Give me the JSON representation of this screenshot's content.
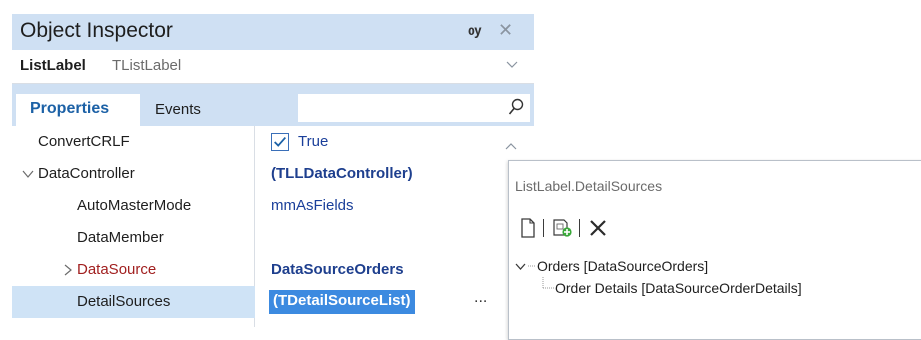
{
  "inspector": {
    "title": "Object Inspector",
    "pin_glyph": "ѹ",
    "close_glyph": "✕",
    "object_name": "ListLabel",
    "object_class": "TListLabel",
    "tabs": [
      {
        "label": "Properties",
        "active": true
      },
      {
        "label": "Events",
        "active": false
      }
    ],
    "search": {
      "value": "",
      "placeholder": ""
    },
    "properties": [
      {
        "name": "ConvertCRLF",
        "value": "True",
        "kind": "checkbox",
        "checked": true
      },
      {
        "name": "DataController",
        "value": "(TLLDataController)",
        "kind": "object",
        "expanded": true
      },
      {
        "name": "AutoMasterMode",
        "value": "mmAsFields",
        "kind": "enum"
      },
      {
        "name": "DataMember",
        "value": "",
        "kind": "string"
      },
      {
        "name": "DataSource",
        "value": "DataSourceOrders",
        "kind": "reference",
        "expanded": false
      },
      {
        "name": "DetailSources",
        "value": "(TDetailSourceList)",
        "kind": "object",
        "selected": true,
        "ellipsis": "..."
      }
    ]
  },
  "detail_sources": {
    "title": "ListLabel.DetailSources",
    "toolbar": [
      "new-icon",
      "add-item-icon",
      "delete-icon"
    ],
    "tree": [
      {
        "label": "Orders [DataSourceOrders]",
        "level": 0,
        "expanded": true
      },
      {
        "label": "Order Details [DataSourceOrderDetails]",
        "level": 1
      }
    ]
  },
  "colors": {
    "title_bar": "#cfe0f3",
    "tab_active_text": "#1c61a6",
    "value_text": "#1e3f8e",
    "reference_name": "#a11f1f",
    "selection": "#3c8ae0",
    "row_highlight": "#cfe3f6"
  }
}
